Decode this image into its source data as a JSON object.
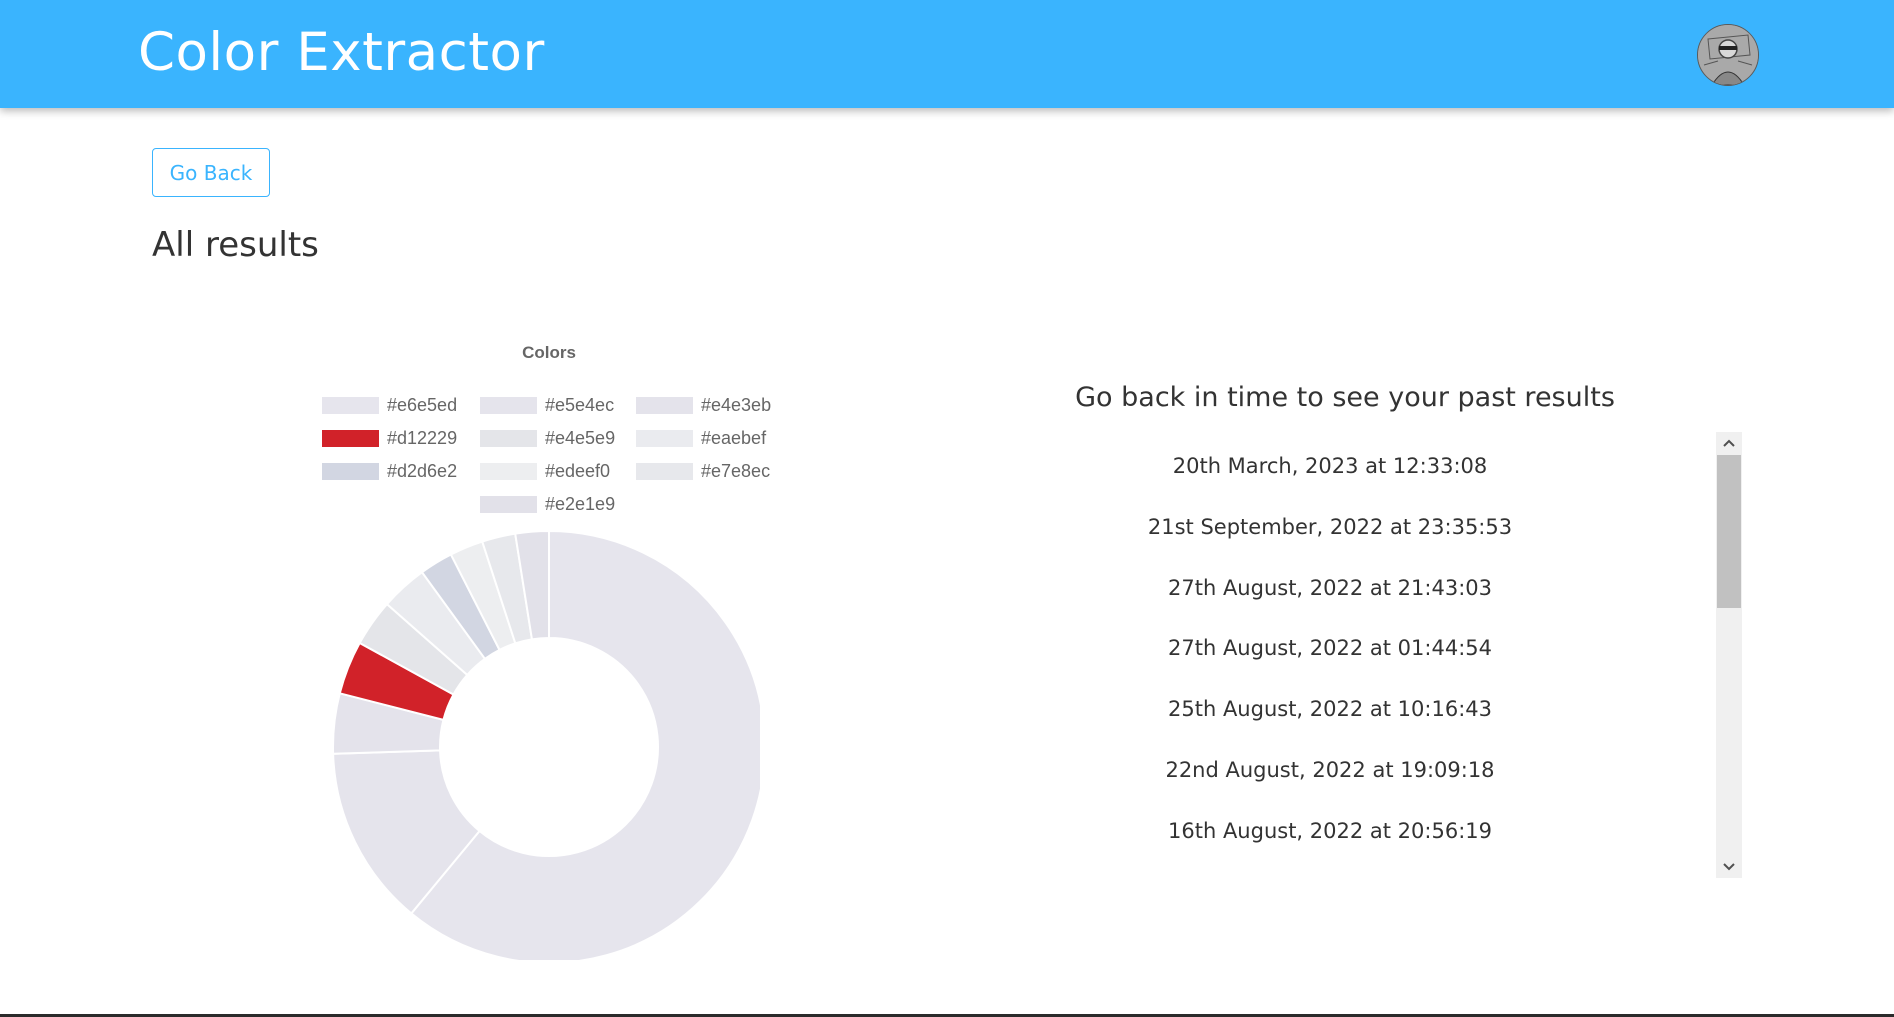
{
  "header": {
    "brand": "Color Extractor",
    "avatar_icon": "user-avatar-icon"
  },
  "actions": {
    "back_label": "Go Back"
  },
  "page": {
    "title": "All results"
  },
  "chart_data": {
    "type": "doughnut",
    "title": "Colors",
    "legend": "top",
    "series": [
      {
        "label": "#e6e5ed",
        "color": "#e6e5ed",
        "value": 61.0
      },
      {
        "label": "#e5e4ec",
        "color": "#e5e4ec",
        "value": 13.5
      },
      {
        "label": "#e4e3eb",
        "color": "#e4e3eb",
        "value": 4.5
      },
      {
        "label": "#d12229",
        "color": "#d12229",
        "value": 4.0
      },
      {
        "label": "#e4e5e9",
        "color": "#e4e5e9",
        "value": 3.5
      },
      {
        "label": "#eaebef",
        "color": "#eaebef",
        "value": 3.5
      },
      {
        "label": "#d2d6e2",
        "color": "#d2d6e2",
        "value": 2.5
      },
      {
        "label": "#edeef0",
        "color": "#edeef0",
        "value": 2.5
      },
      {
        "label": "#e7e8ec",
        "color": "#e7e8ec",
        "value": 2.5
      },
      {
        "label": "#e2e1e9",
        "color": "#e2e1e9",
        "value": 2.5
      }
    ]
  },
  "history": {
    "heading": "Go back in time to see your past results",
    "items": [
      "20th March, 2023 at 12:33:08",
      "21st September, 2022 at 23:35:53",
      "27th August, 2022 at 21:43:03",
      "27th August, 2022 at 01:44:54",
      "25th August, 2022 at 10:16:43",
      "22nd August, 2022 at 19:09:18",
      "16th August, 2022 at 20:56:19"
    ],
    "scroll_up_icon": "chevron-up-icon",
    "scroll_down_icon": "chevron-down-icon"
  }
}
